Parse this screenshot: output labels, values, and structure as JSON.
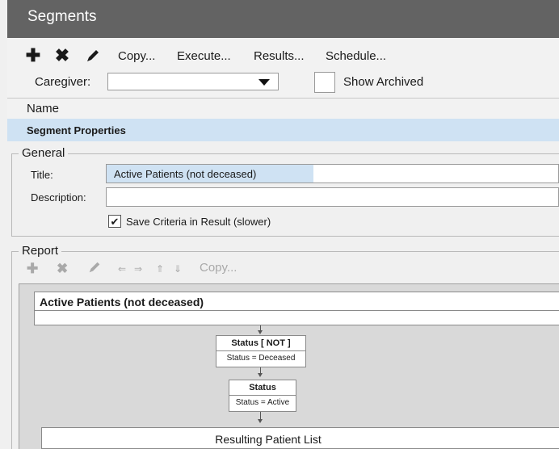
{
  "window": {
    "title": "Segments"
  },
  "toolbar": {
    "copy_label": "Copy...",
    "execute_label": "Execute...",
    "results_label": "Results...",
    "schedule_label": "Schedule...",
    "caregiver_label": "Caregiver:",
    "caregiver_value": "",
    "show_archived_label": "Show Archived",
    "show_archived_checked": false
  },
  "list": {
    "name_header": "Name"
  },
  "properties": {
    "header": "Segment Properties",
    "general_legend": "General",
    "title_label": "Title:",
    "title_value": "Active Patients (not deceased)",
    "description_label": "Description:",
    "description_value": "",
    "save_criteria_label": "Save Criteria in Result (slower)",
    "save_criteria_checked": true
  },
  "report": {
    "legend": "Report",
    "copy_label": "Copy...",
    "segment_title": "Active Patients (not deceased)",
    "nodes": [
      {
        "title": "Status [ NOT ]",
        "detail": "Status = Deceased"
      },
      {
        "title": "Status",
        "detail": "Status = Active"
      }
    ],
    "result_label": "Resulting Patient List"
  }
}
